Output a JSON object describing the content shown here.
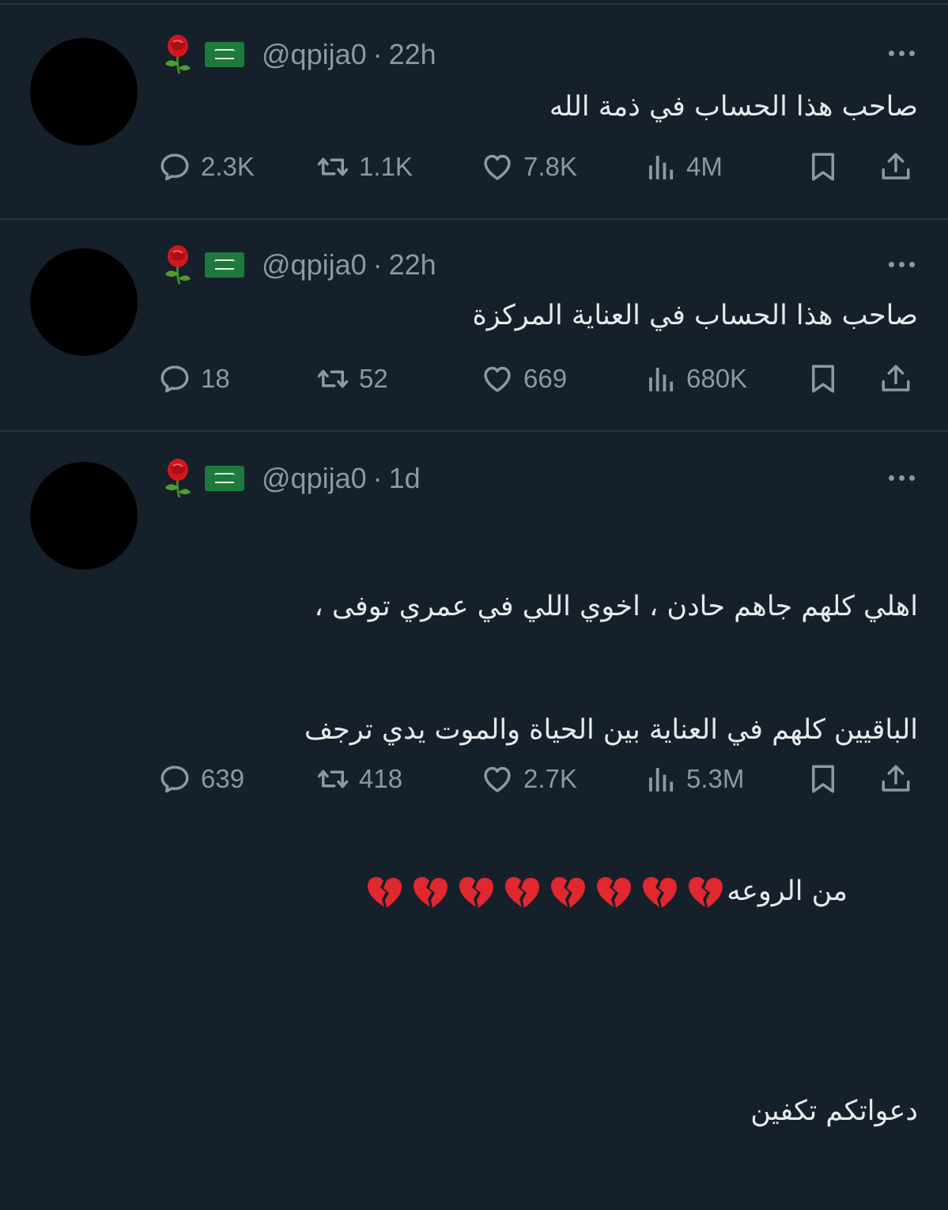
{
  "colors": {
    "background": "#15202b",
    "text": "#e7e9ea",
    "muted": "#8b98a5",
    "divider": "#2b3540",
    "flag_green": "#1d7a3c",
    "heart_red": "#e0282e"
  },
  "tweets": [
    {
      "handle": "@qpija0",
      "separator": "·",
      "time": "22h",
      "text": "صاحب هذا الحساب في ذمة الله",
      "replies": "2.3K",
      "reposts": "1.1K",
      "likes": "7.8K",
      "views": "4M"
    },
    {
      "handle": "@qpija0",
      "separator": "·",
      "time": "22h",
      "text": "صاحب هذا الحساب في العناية المركزة",
      "replies": "18",
      "reposts": "52",
      "likes": "669",
      "views": "680K"
    },
    {
      "handle": "@qpija0",
      "separator": "·",
      "time": "1d",
      "text_line1": "اهلي كلهم جاهم حادن ، اخوي اللي في عمري توفى ،",
      "text_line2": "الباقيين كلهم في العناية بين الحياة والموت يدي ترجف",
      "text_line3": "من الروعه",
      "broken_hearts_count": 8,
      "text_line4": "دعواتكم تكفين",
      "replies": "639",
      "reposts": "418",
      "likes": "2.7K",
      "views": "5.3M"
    }
  ],
  "icons": {
    "header": [
      "rose-emoji-icon",
      "saudi-flag-icon",
      "more-options-icon"
    ],
    "actions": [
      "reply-icon",
      "repost-icon",
      "like-icon",
      "views-icon",
      "bookmark-icon",
      "share-icon"
    ],
    "inline": [
      "broken-heart-emoji-icon"
    ]
  }
}
